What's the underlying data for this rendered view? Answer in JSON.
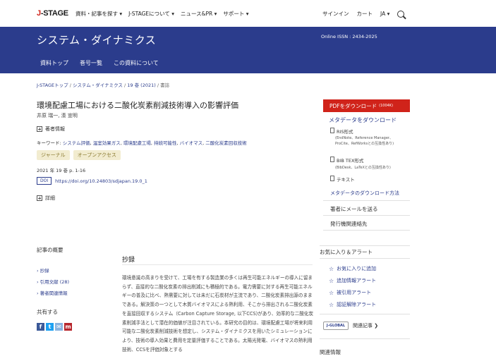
{
  "topnav": {
    "logo": "J-STAGE",
    "menu": [
      "資料・記事を探す ▾",
      "J-STAGEについて ▾",
      "ニュース&PR ▾",
      "サポート ▾"
    ],
    "signin": "サインイン",
    "cart": "カート",
    "lang": "JA ▾"
  },
  "banner": {
    "title": "システム・ダイナミクス",
    "issn": "Online ISSN : 2434-2025",
    "tabs": [
      "資料トップ",
      "巻号一覧",
      "この資料について"
    ]
  },
  "breadcrumb": {
    "items": [
      "J-STAGEトップ",
      "システム・ダイナミクス",
      "19 巻 (2021)"
    ],
    "current": "書誌"
  },
  "article": {
    "title": "環境配慮工場における二酸化炭素削減技術導入の影響評価",
    "authors": "井原 瑞一, 湊 宣明",
    "author_info": "著者情報",
    "keywords_label": "キーワード:",
    "keywords": [
      "システム評価",
      "温室効果ガス",
      "環境配慮工場",
      "持続可能性",
      "バイオマス",
      "二酸化炭素回収技術"
    ],
    "tags": [
      "ジャーナル",
      "オープンアクセス"
    ],
    "pubinfo": "2021 年 19 巻 p. 1-16",
    "doi_badge": "DOI",
    "doi": "https://doi.org/10.24803/sdjapan.19.0_1",
    "details": "詳細"
  },
  "right": {
    "pdf_label": "PDFをダウンロード",
    "pdf_size": "(1004K)",
    "meta_title": "メタデータをダウンロード",
    "ris_label": "RIS形式",
    "ris_sub1": "(EndNote、Reference Manager、",
    "ris_sub2": "ProCite、RefWorksとの互換性あり)",
    "bib_label": "BIB TEX形式",
    "bib_sub": "(BibDesk、LaTeXとの互換性あり)",
    "text_label": "テキスト",
    "howto": "メタデータのダウンロード方法",
    "mail": "著者にメールを送る",
    "publisher": "発行機関連絡先"
  },
  "sidebar": {
    "summary_head": "記事の概要",
    "links": [
      "抄録",
      "引用文献 (28)",
      "著者関連情報"
    ],
    "share_head": "共有する"
  },
  "abstract": {
    "heading": "抄録",
    "text": "環境意識の高まりを受けて、工場を有する製造業の多くは再生可能エネルギーの導入に留まらず、直接的な二酸化炭素の排出削減にも積極的である。電力需要に対する再生可能エネルギーの普及に比べ、熱需要に対しては未だに石炭材が主流であり、二酸化炭素排出源のままである。解決策の一つとして木質バイオマスによる熱利用、そこから排出される二酸化炭素を直接回収するシステム（Carbon Capture Storage, 以下CCS)があり、効率的な二酸化炭素削減手法として潜在的価値が注目されている。本研究の目的は、環境配慮工場が将来利用可能な二酸化炭素削減技術を想定し、システム・ダイナミクスを用いたシミュレーションにより、技術の導入効果と費用を定量評価することである。太陽光発電、バイオマスの熱利用技術、CCSを評価対象とする"
  },
  "favorites": {
    "heading": "お気に入り＆アラート",
    "items": [
      "お気に入りに追加",
      "追加情報アラート",
      "被引用アラート",
      "認証解除アラート"
    ],
    "jglobal_logo": "J-GLOBAL",
    "jglobal_label": "関連記事 ❯",
    "related": "関連情報"
  },
  "colors": {
    "brand": "#2b3c8c",
    "pdf": "#d0231a",
    "tag_bg": "#f2ecd0"
  }
}
